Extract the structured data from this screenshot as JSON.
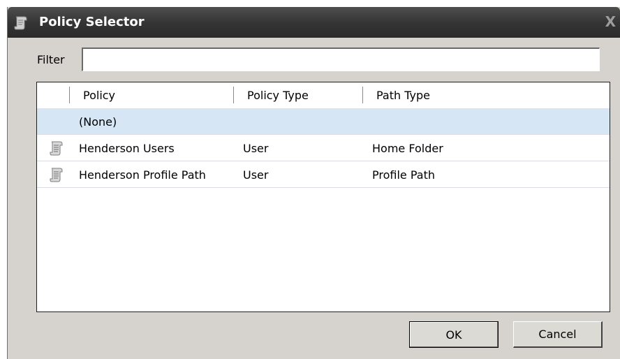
{
  "window": {
    "title": "Policy Selector",
    "close_label": "X",
    "title_icon": "policy-scroll-icon"
  },
  "filter": {
    "label": "Filter",
    "value": "",
    "placeholder": ""
  },
  "grid": {
    "columns": [
      "Policy",
      "Policy Type",
      "Path Type"
    ],
    "rows": [
      {
        "icon": "",
        "policy": "(None)",
        "policy_type": "",
        "path_type": "",
        "selected": true
      },
      {
        "icon": "policy-scroll-icon",
        "policy": "Henderson Users",
        "policy_type": "User",
        "path_type": "Home Folder",
        "selected": false
      },
      {
        "icon": "policy-scroll-icon",
        "policy": "Henderson Profile Path",
        "policy_type": "User",
        "path_type": "Profile Path",
        "selected": false
      }
    ]
  },
  "buttons": {
    "ok_label": "OK",
    "cancel_label": "Cancel"
  },
  "colors": {
    "titlebar": "#353535",
    "selection": "#d6e6f5",
    "dialog_bg": "#d6d3ce"
  }
}
